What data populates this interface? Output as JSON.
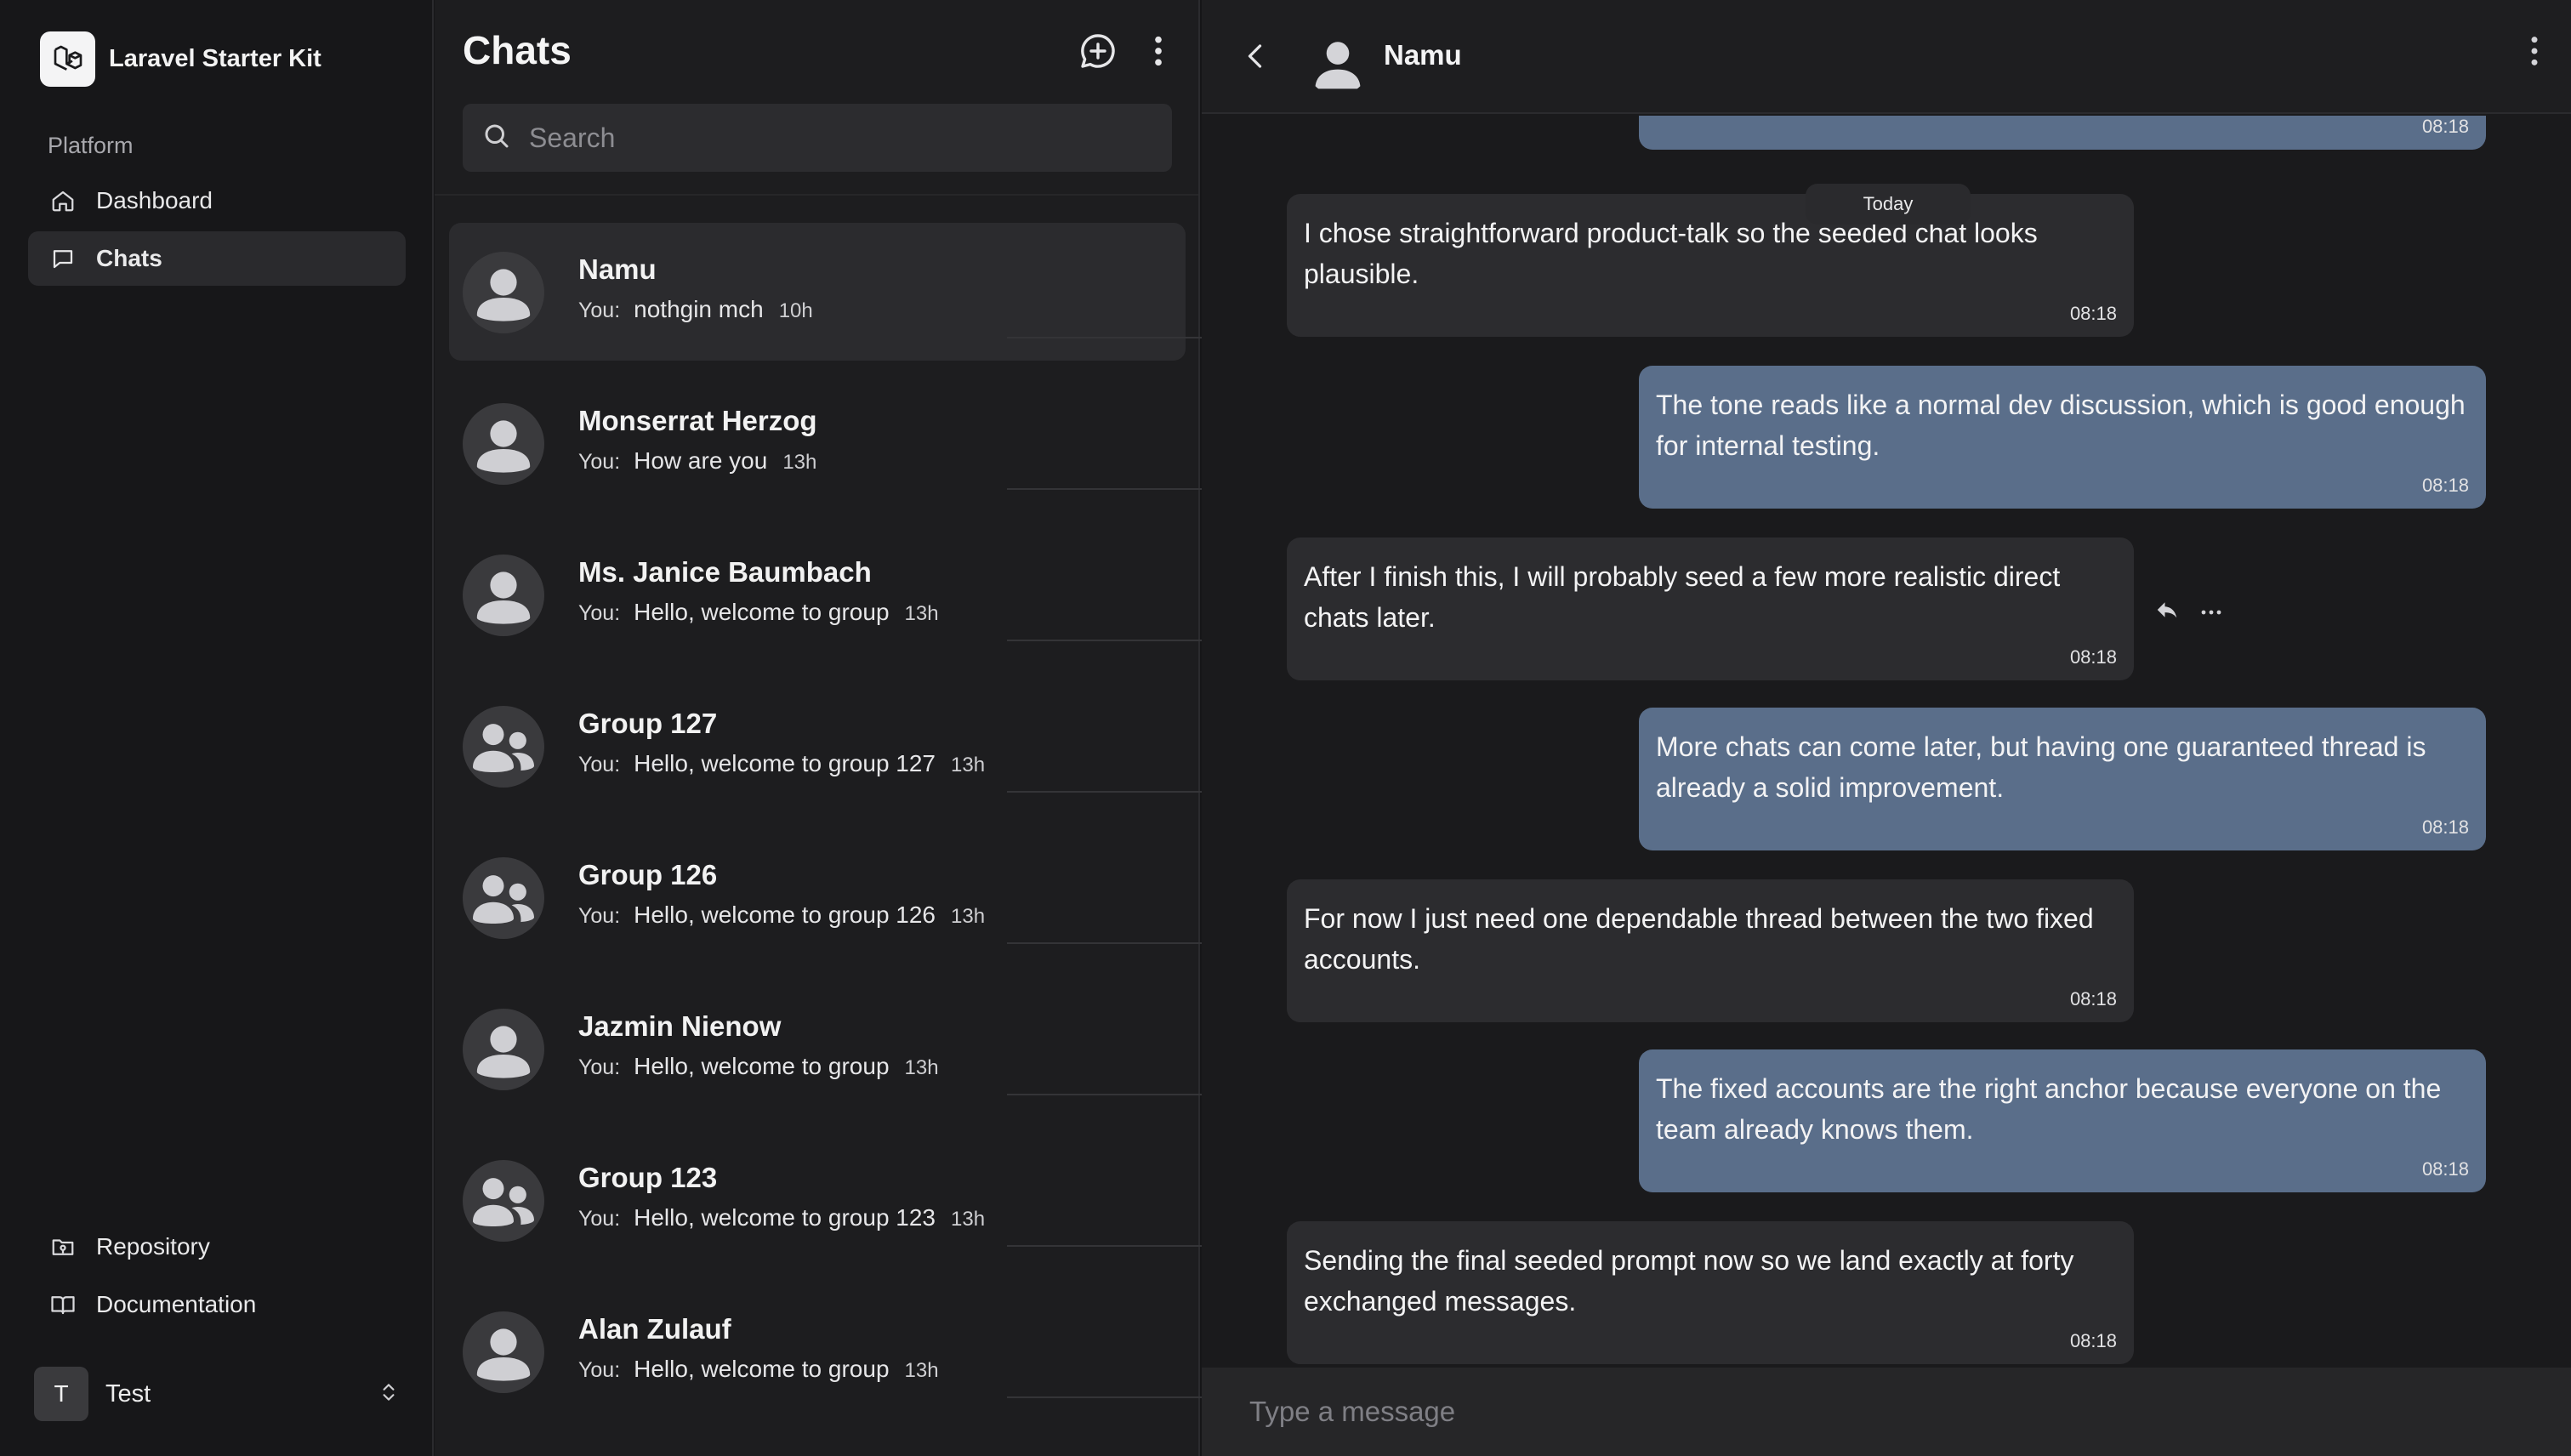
{
  "sidebar": {
    "brand": "Laravel Starter Kit",
    "group_label": "Platform",
    "nav": [
      {
        "label": "Dashboard",
        "icon": "home-icon"
      },
      {
        "label": "Chats",
        "icon": "message-square-icon"
      }
    ],
    "footer_links": [
      {
        "label": "Repository",
        "icon": "folder-git-icon"
      },
      {
        "label": "Documentation",
        "icon": "book-open-icon"
      }
    ],
    "user": {
      "initial": "T",
      "name": "Test"
    }
  },
  "chatlist": {
    "title": "Chats",
    "search_placeholder": "Search",
    "you_label": "You:",
    "items": [
      {
        "name": "Namu",
        "preview": "nothgin mch",
        "time": "10h",
        "type": "user"
      },
      {
        "name": "Monserrat Herzog",
        "preview": "How are you",
        "time": "13h",
        "type": "user"
      },
      {
        "name": "Ms. Janice Baumbach",
        "preview": "Hello, welcome to group",
        "time": "13h",
        "type": "user"
      },
      {
        "name": "Group 127",
        "preview": "Hello, welcome to group 127",
        "time": "13h",
        "type": "group"
      },
      {
        "name": "Group 126",
        "preview": "Hello, welcome to group 126",
        "time": "13h",
        "type": "group"
      },
      {
        "name": "Jazmin Nienow",
        "preview": "Hello, welcome to group",
        "time": "13h",
        "type": "user"
      },
      {
        "name": "Group 123",
        "preview": "Hello, welcome to group 123",
        "time": "13h",
        "type": "group"
      },
      {
        "name": "Alan Zulauf",
        "preview": "Hello, welcome to group",
        "time": "13h",
        "type": "user"
      }
    ]
  },
  "conversation": {
    "name": "Namu",
    "date_divider": "Today",
    "composer_placeholder": "Type a message",
    "messages": [
      {
        "direction": "out",
        "text": "",
        "time": "08:18"
      },
      {
        "direction": "in",
        "text": "I chose straightforward product-talk so the seeded chat looks plausible.",
        "time": "08:18"
      },
      {
        "direction": "out",
        "text": "The tone reads like a normal dev discussion, which is good enough for internal testing.",
        "time": "08:18"
      },
      {
        "direction": "in",
        "text": "After I finish this, I will probably seed a few more realistic direct chats later.",
        "time": "08:18"
      },
      {
        "direction": "out",
        "text": "More chats can come later, but having one guaranteed thread is already a solid improvement.",
        "time": "08:18"
      },
      {
        "direction": "in",
        "text": "For now I just need one dependable thread between the two fixed accounts.",
        "time": "08:18"
      },
      {
        "direction": "out",
        "text": "The fixed accounts are the right anchor because everyone on the team already knows them.",
        "time": "08:18"
      },
      {
        "direction": "in",
        "text": "Sending the final seeded prompt now so we land exactly at forty exchanged messages.",
        "time": "08:18"
      }
    ]
  }
}
